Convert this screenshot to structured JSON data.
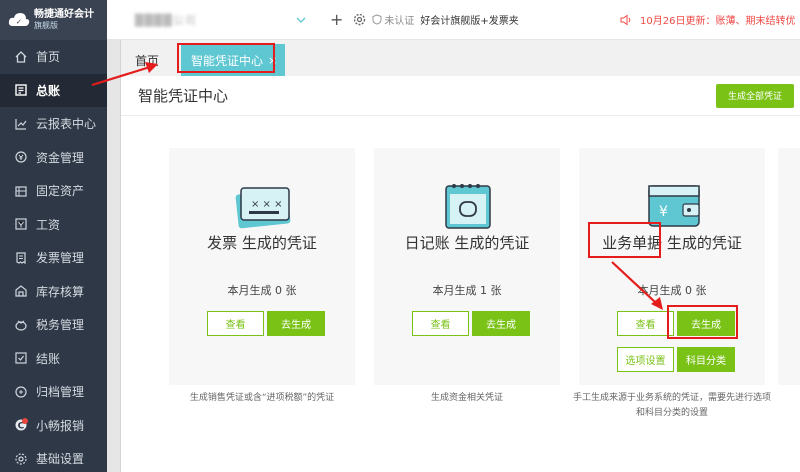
{
  "app": {
    "logo_title": "畅捷通好会计",
    "logo_sub": "旗舰版"
  },
  "topbar": {
    "company_name": "████公司",
    "plus": "+",
    "verify_label": "未认证",
    "brand_label": "好会计旗舰版+发票夹",
    "notice": "10月26日更新：账薄、期末结转优"
  },
  "sidebar": {
    "items": [
      {
        "label": "首页",
        "icon": "home-icon"
      },
      {
        "label": "总账",
        "icon": "ledger-icon",
        "active": true
      },
      {
        "label": "云报表中心",
        "icon": "chart-icon"
      },
      {
        "label": "资金管理",
        "icon": "money-icon"
      },
      {
        "label": "固定资产",
        "icon": "asset-icon"
      },
      {
        "label": "工资",
        "icon": "salary-icon"
      },
      {
        "label": "发票管理",
        "icon": "invoice-icon"
      },
      {
        "label": "库存核算",
        "icon": "inventory-icon"
      },
      {
        "label": "税务管理",
        "icon": "tax-icon"
      },
      {
        "label": "结账",
        "icon": "checkout-icon"
      },
      {
        "label": "归档管理",
        "icon": "archive-icon"
      },
      {
        "label": "小畅报销",
        "icon": "reimburse-icon"
      },
      {
        "label": "基础设置",
        "icon": "settings-icon"
      }
    ]
  },
  "tabs": {
    "home": "首页",
    "active": "智能凭证中心",
    "close": "×"
  },
  "content": {
    "title": "智能凭证中心",
    "generate_all": "生成全部凭证"
  },
  "cards": [
    {
      "title": "发票 生成的凭证",
      "count": "本月生成 0 张",
      "view": "查看",
      "generate": "去生成",
      "desc": "生成销售凭证或含“进项税额”的凭证"
    },
    {
      "title": "日记账 生成的凭证",
      "count": "本月生成 1 张",
      "view": "查看",
      "generate": "去生成",
      "desc": "生成资金相关凭证"
    },
    {
      "title_a": "业务单据",
      "title_b": " 生成的凭证",
      "count": "本月生成 0 张",
      "view": "查看",
      "generate": "去生成",
      "options": "选项设置",
      "subject": "科目分类",
      "desc": "手工生成来源于业务系统的凭证，需要先进行选项和科目分类的设置"
    }
  ],
  "colors": {
    "accent_green": "#7ac216",
    "tab_teal": "#5ec7d1",
    "sidebar_bg": "#2f3846",
    "annotation_red": "#e41c1c"
  }
}
